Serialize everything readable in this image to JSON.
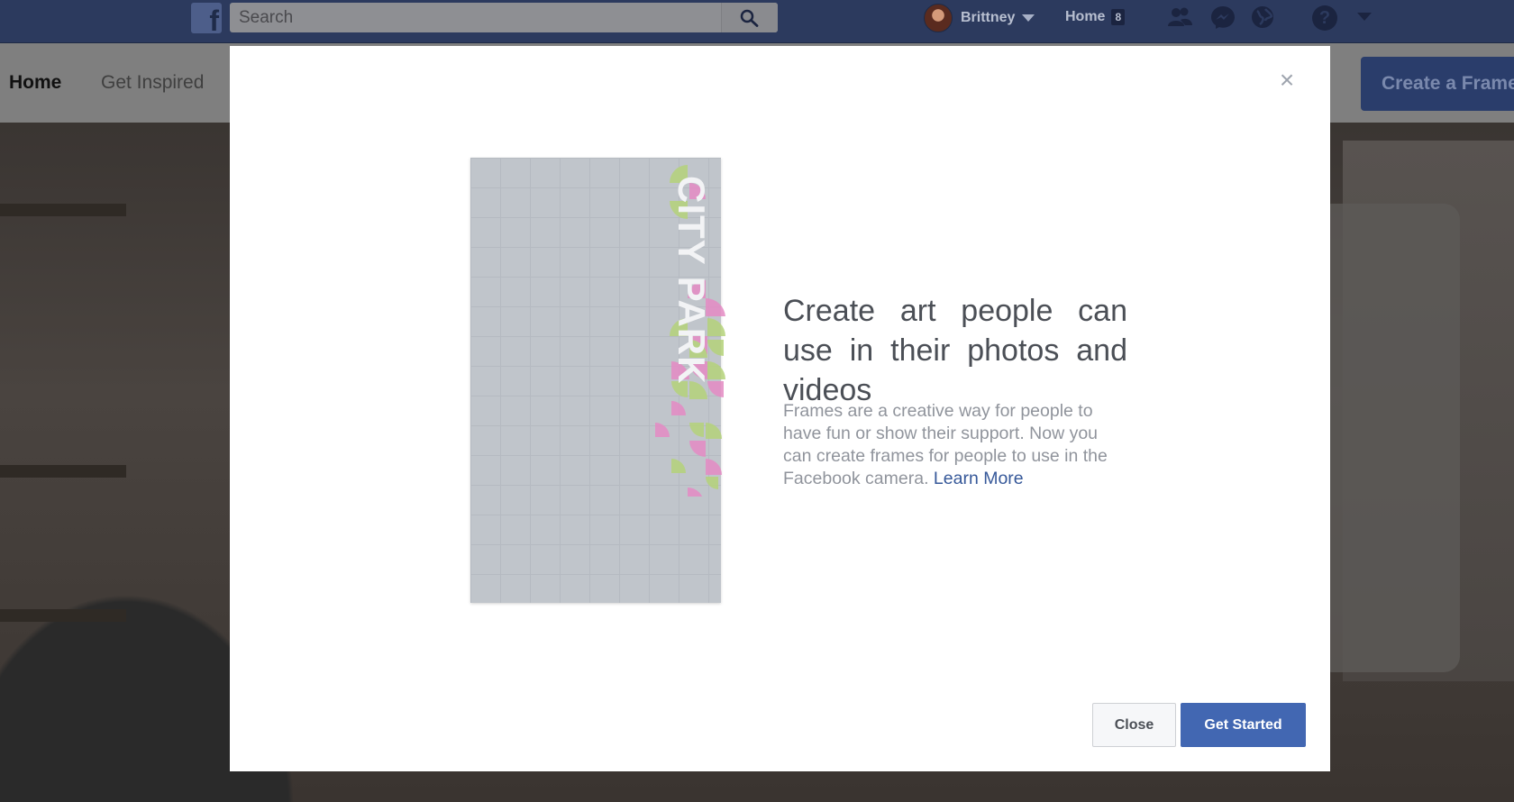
{
  "topbar": {
    "logo": "f",
    "search_placeholder": "Search",
    "user_name": "Brittney",
    "home_label": "Home",
    "home_count": "8",
    "help_symbol": "?",
    "icons": [
      "facebook-logo",
      "search-icon",
      "profile-avatar",
      "chevron-down-icon",
      "friends-icon",
      "messenger-icon",
      "notifications-globe-icon",
      "help-icon",
      "chevron-down-icon"
    ]
  },
  "subnav": {
    "home_label": "Home",
    "inspired_label": "Get Inspired",
    "create_label": "Create a Frame"
  },
  "modal": {
    "close_symbol": "×",
    "preview_art_text": "CITY PARK",
    "headline": "Create art people can use in their photos and videos",
    "body": "Frames are a creative way for people to have fun or show their support. Now you can create frames for people to use in the Facebook camera.",
    "learn_more": "Learn More",
    "close_button": "Close",
    "start_button": "Get Started"
  },
  "colors": {
    "topbar_dimmed": "#2c3a5e",
    "primary_button": "#4267b2",
    "link": "#365899",
    "art_pink": "#e58bc4",
    "art_green": "#b5d37a"
  }
}
